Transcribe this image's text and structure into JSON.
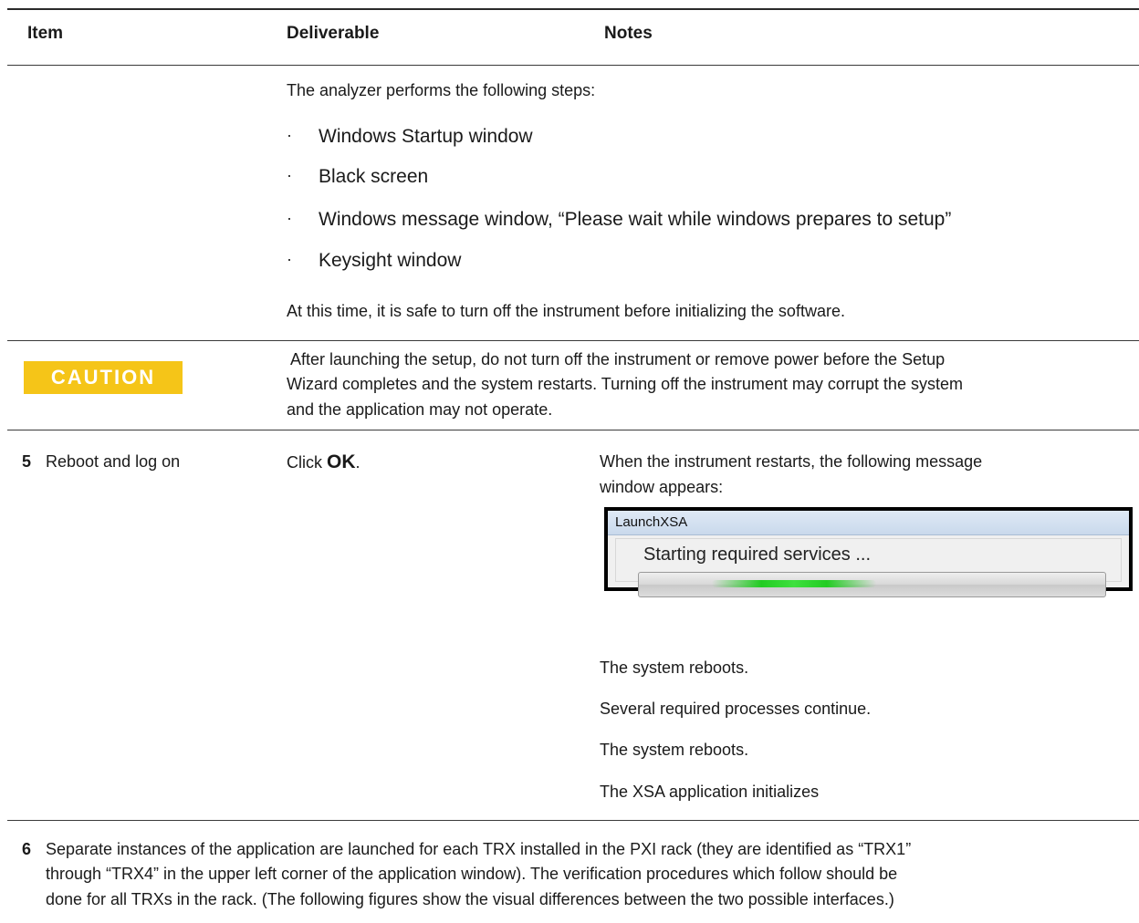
{
  "header": {
    "item": "Item",
    "deliverable": "Deliverable",
    "notes": "Notes"
  },
  "steps_intro": "The analyzer performs the following steps:",
  "steps": [
    "Windows Startup window",
    "Black screen",
    "Windows message window, “Please wait while windows prepares to setup”",
    "Keysight window"
  ],
  "bullet_glyph": "·",
  "safe_note": "At this time, it is safe to turn off the instrument before initializing the software.",
  "caution": {
    "label": "CAUTION",
    "line1": " After launching the setup, do not turn off the instrument or remove power before the Setup",
    "line2": "Wizard completes and the system restarts. Turning off the instrument may corrupt the system",
    "line3": "and the application may not operate.",
    "color": "#f5c518"
  },
  "row5": {
    "number": "5",
    "item": "Reboot and log on",
    "deliverable_prefix": "Click ",
    "deliverable_bold": "OK",
    "deliverable_suffix": ".",
    "notes_line1": "When the instrument restarts, the following message",
    "notes_line2": "window appears:",
    "window": {
      "title": "LaunchXSA",
      "message": "Starting required services ..."
    },
    "after": [
      "The system reboots.",
      "Several required processes continue.",
      "The system reboots.",
      "The XSA application initializes"
    ]
  },
  "row6": {
    "number": "6",
    "line1": "Separate instances of the application are launched for each TRX installed in the PXI rack (they are identified as “TRX1”",
    "line2": "through “TRX4” in the upper left corner of the application window). The verification procedures which follow should be",
    "line3": "done for all TRXs in the rack. (The following figures show the visual differences between the two possible interfaces.)"
  }
}
